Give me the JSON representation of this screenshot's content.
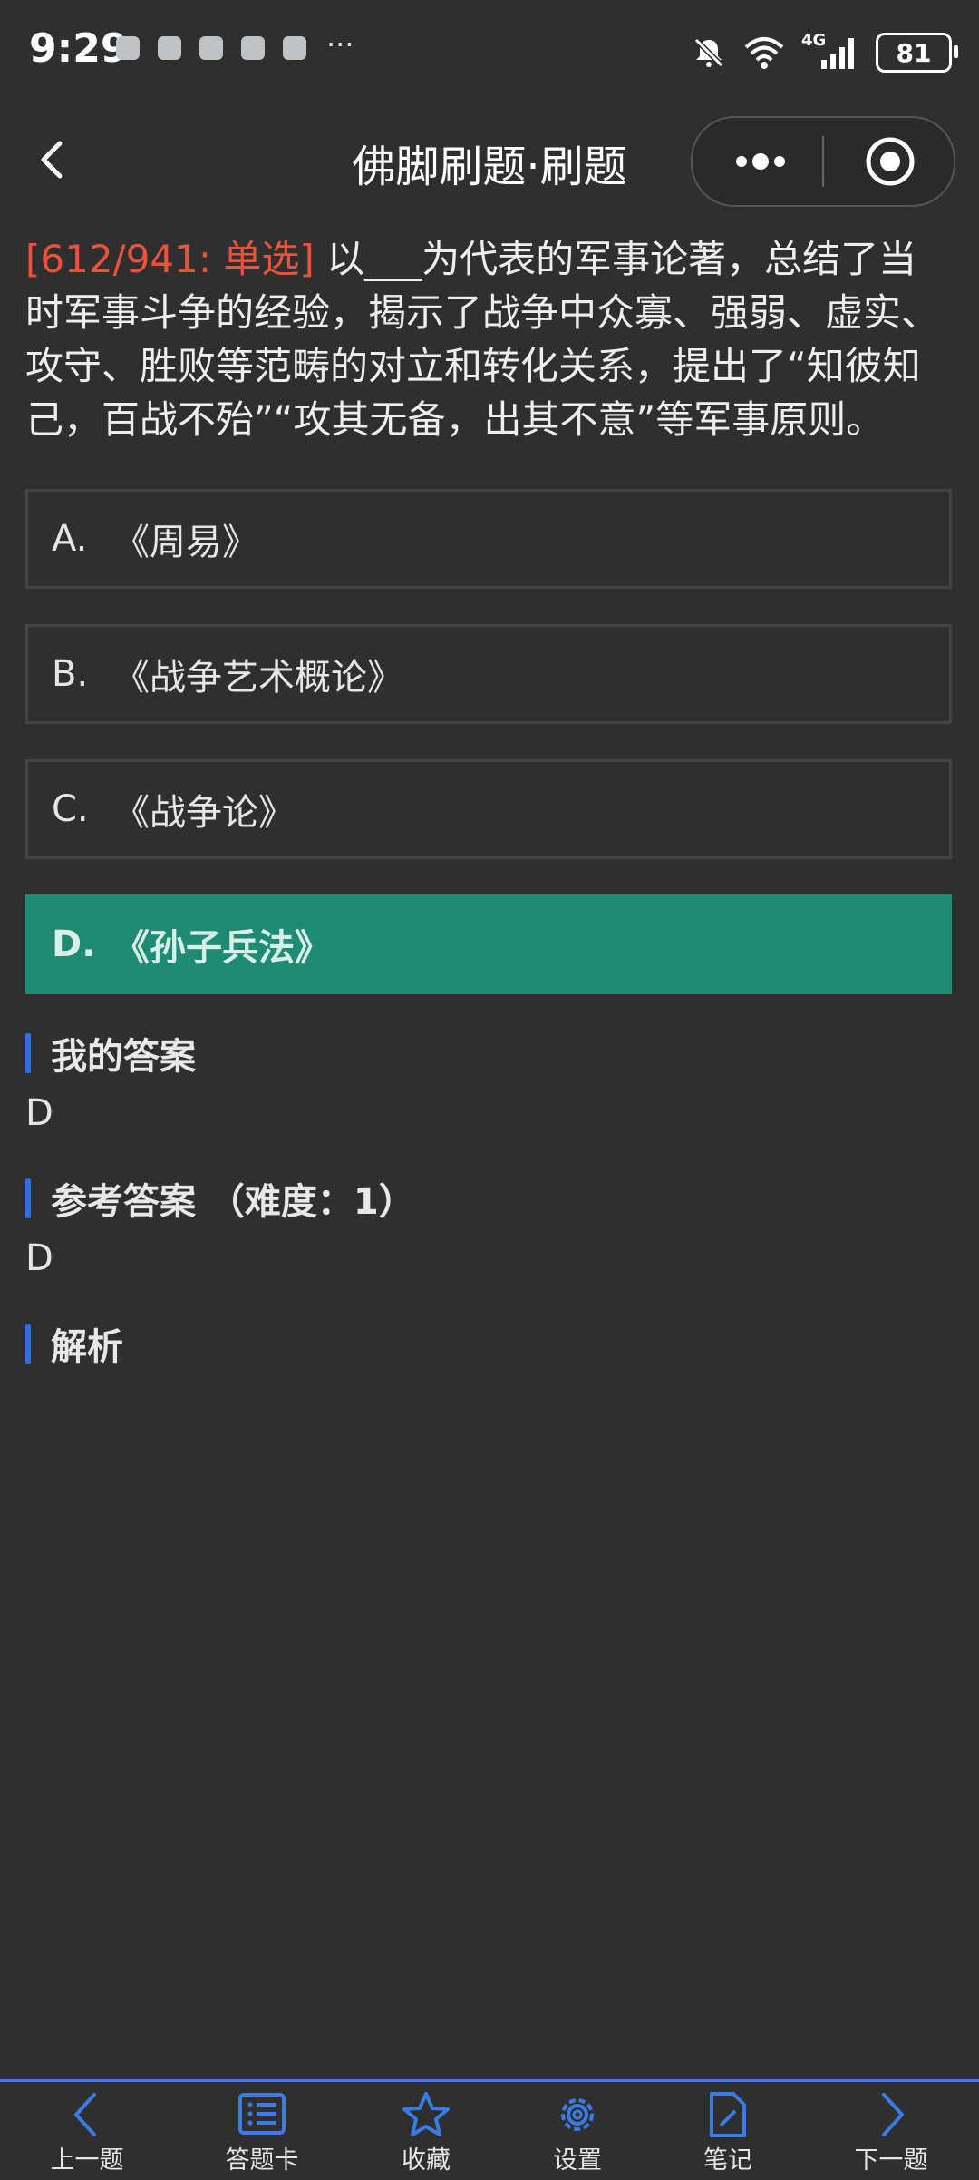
{
  "status": {
    "time": "9:29",
    "network": "4G",
    "battery": "81"
  },
  "header": {
    "title": "佛脚刷题·刷题"
  },
  "question": {
    "tag": "[612/941: 单选]",
    "text": " 以___为代表的军事论著，总结了当时军事斗争的经验，揭示了战争中众寡、强弱、虚实、攻守、胜败等范畴的对立和转化关系，提出了“知彼知己，百战不殆”“攻其无备，出其不意”等军事原则。"
  },
  "options": [
    {
      "letter": "A.",
      "text": "《周易》"
    },
    {
      "letter": "B.",
      "text": "《战争艺术概论》"
    },
    {
      "letter": "C.",
      "text": "《战争论》"
    },
    {
      "letter": "D.",
      "text": "《孙子兵法》"
    }
  ],
  "my_answer": {
    "title": "我的答案",
    "value": "D"
  },
  "reference_answer": {
    "title": "参考答案 （难度：1）",
    "value": "D"
  },
  "analysis": {
    "title": "解析"
  },
  "toolbar": {
    "prev": "上一题",
    "card": "答题卡",
    "favorite": "收藏",
    "settings": "设置",
    "notes": "笔记",
    "next": "下一题"
  },
  "colors": {
    "accent_blue": "#2f6fe0",
    "selected_green": "#208b73",
    "tag_red": "#e8533b"
  }
}
